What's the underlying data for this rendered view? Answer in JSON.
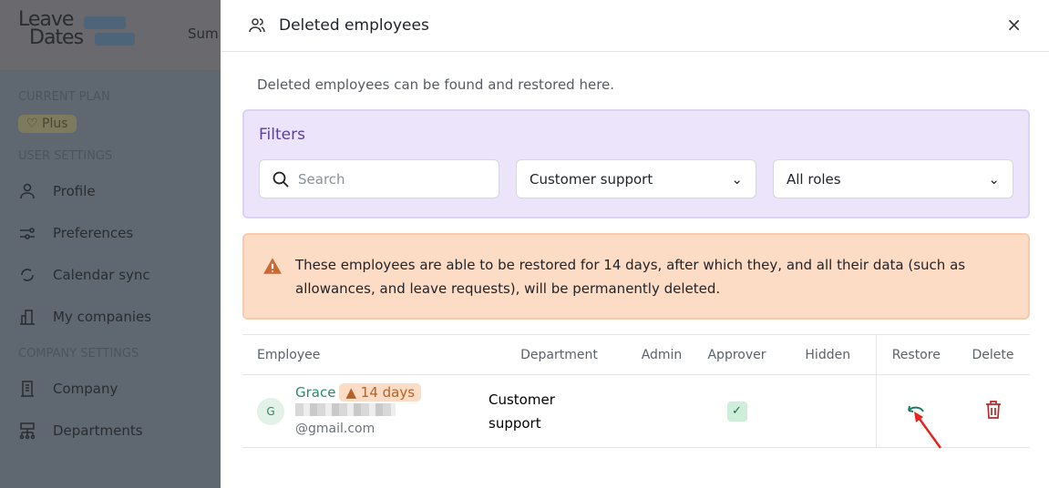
{
  "background": {
    "logo": "Leave Dates",
    "summary_tab": "Sum",
    "current_plan_label": "CURRENT PLAN",
    "plan": "Plus",
    "user_settings_label": "USER SETTINGS",
    "user_items": [
      "Profile",
      "Preferences",
      "Calendar sync",
      "My companies"
    ],
    "company_settings_label": "COMPANY SETTINGS",
    "company_items": [
      "Company",
      "Departments"
    ]
  },
  "drawer": {
    "title": "Deleted employees",
    "close": "×",
    "description": "Deleted employees can be found and restored here.",
    "filters": {
      "title": "Filters",
      "search_placeholder": "Search",
      "department": "Customer support",
      "role": "All roles"
    },
    "warning": "These employees are able to be restored for 14 days, after which they, and all their data (such as allowances, and leave requests), will be permanently deleted.",
    "table": {
      "headers": [
        "Employee",
        "Department",
        "Admin",
        "Approver",
        "Hidden",
        "Restore",
        "Delete"
      ],
      "rows": [
        {
          "initial": "G",
          "name": "Grace",
          "badge": "14 days",
          "email_suffix": "@gmail.com",
          "department": "Customer support",
          "admin": false,
          "approver": true,
          "hidden": false
        }
      ]
    }
  }
}
